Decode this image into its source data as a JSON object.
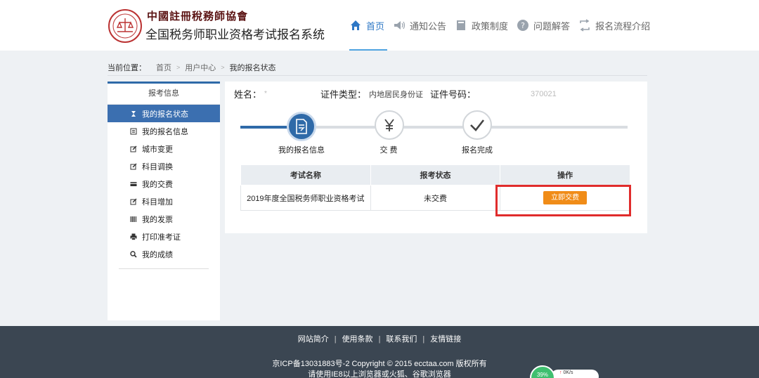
{
  "header": {
    "brand_script": "中國註冊稅務師協會",
    "brand_title": "全国税务师职业资格考试报名系统",
    "nav": [
      {
        "label": "首页",
        "icon": "home-icon",
        "active": true
      },
      {
        "label": "通知公告",
        "icon": "speaker-icon",
        "active": false
      },
      {
        "label": "政策制度",
        "icon": "book-icon",
        "active": false
      },
      {
        "label": "问题解答",
        "icon": "question-icon",
        "active": false
      },
      {
        "label": "报名流程介绍",
        "icon": "flow-icon",
        "active": false
      }
    ]
  },
  "breadcrumb": {
    "label": "当前位置：",
    "items": [
      "首页",
      "用户中心",
      "我的报名状态"
    ]
  },
  "sidebar": {
    "title": "报考信息",
    "items": [
      {
        "label": "我的报名状态",
        "icon": "hourglass-icon",
        "active": true
      },
      {
        "label": "我的报名信息",
        "icon": "list-icon",
        "active": false
      },
      {
        "label": "城市变更",
        "icon": "edit-icon",
        "active": false
      },
      {
        "label": "科目调换",
        "icon": "edit-icon",
        "active": false
      },
      {
        "label": "我的交费",
        "icon": "card-icon",
        "active": false
      },
      {
        "label": "科目增加",
        "icon": "edit-icon",
        "active": false
      },
      {
        "label": "我的发票",
        "icon": "barcode-icon",
        "active": false
      },
      {
        "label": "打印准考证",
        "icon": "printer-icon",
        "active": false
      },
      {
        "label": "我的成绩",
        "icon": "magnifier-icon",
        "active": false
      }
    ]
  },
  "info": {
    "name_label": "姓名：",
    "name_value": "*",
    "id_type_label": "证件类型：",
    "id_type_value": "内地居民身份证",
    "id_no_label": "证件号码：",
    "id_no_value": "370021"
  },
  "steps": [
    {
      "label": "我的报名信息",
      "icon": "document-icon",
      "done": true
    },
    {
      "label": "交 费",
      "icon": "yen-icon",
      "done": false
    },
    {
      "label": "报名完成",
      "icon": "check-icon",
      "done": false
    }
  ],
  "table": {
    "headers": [
      "考试名称",
      "报考状态",
      "操作"
    ],
    "rows": [
      {
        "exam": "2019年度全国税务师职业资格考试",
        "status": "未交费",
        "action": "立即交费"
      }
    ]
  },
  "footer": {
    "links": [
      "网站简介",
      "使用条款",
      "联系我们",
      "友情链接"
    ],
    "line1": "京ICP备13031883号-2 Copyright © 2015 ecctaa.com 版权所有",
    "line2": "请使用IE8以上浏览器或火狐、谷歌浏览器"
  },
  "speed_widget": {
    "percent": "39%",
    "rate": "0K/s"
  },
  "colors": {
    "accent": "#2f6aa8",
    "nav_active": "#2e78c6",
    "pay_button": "#f08c18",
    "highlight": "#e02c2c",
    "footer_bg": "#3b4652"
  }
}
